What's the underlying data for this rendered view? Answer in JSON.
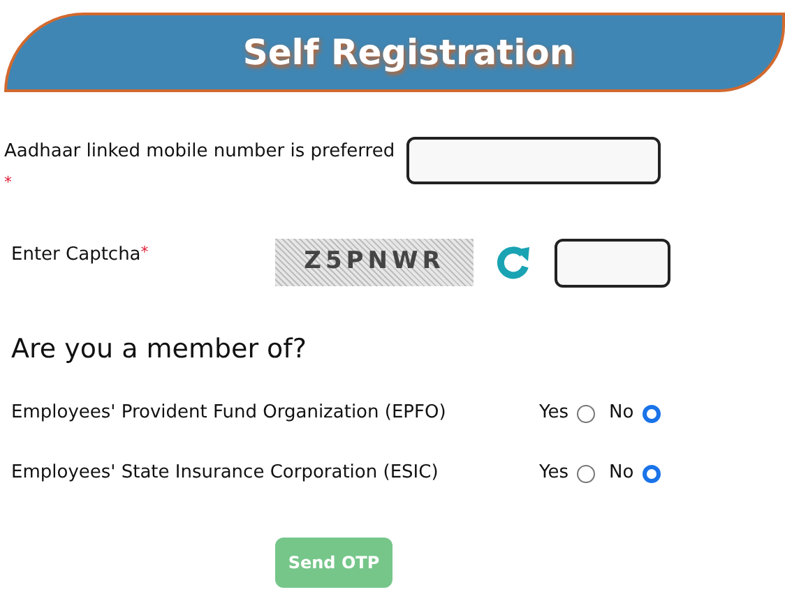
{
  "header": {
    "title": "Self Registration"
  },
  "mobile": {
    "label": "Aadhaar linked mobile number is preferred",
    "required_mark": "*"
  },
  "captcha": {
    "label": "Enter Captcha",
    "required_mark": "*",
    "code": "Z5PNWR"
  },
  "membership": {
    "heading": "Are you a member of?",
    "rows": [
      {
        "label": "Employees' Provident Fund Organization (EPFO)",
        "options": [
          {
            "label": "Yes",
            "selected": false
          },
          {
            "label": "No",
            "selected": true
          }
        ]
      },
      {
        "label": "Employees' State Insurance Corporation (ESIC)",
        "options": [
          {
            "label": "Yes",
            "selected": false
          },
          {
            "label": "No",
            "selected": true
          }
        ]
      }
    ]
  },
  "submit": {
    "label": "Send OTP",
    "disabled": true
  }
}
